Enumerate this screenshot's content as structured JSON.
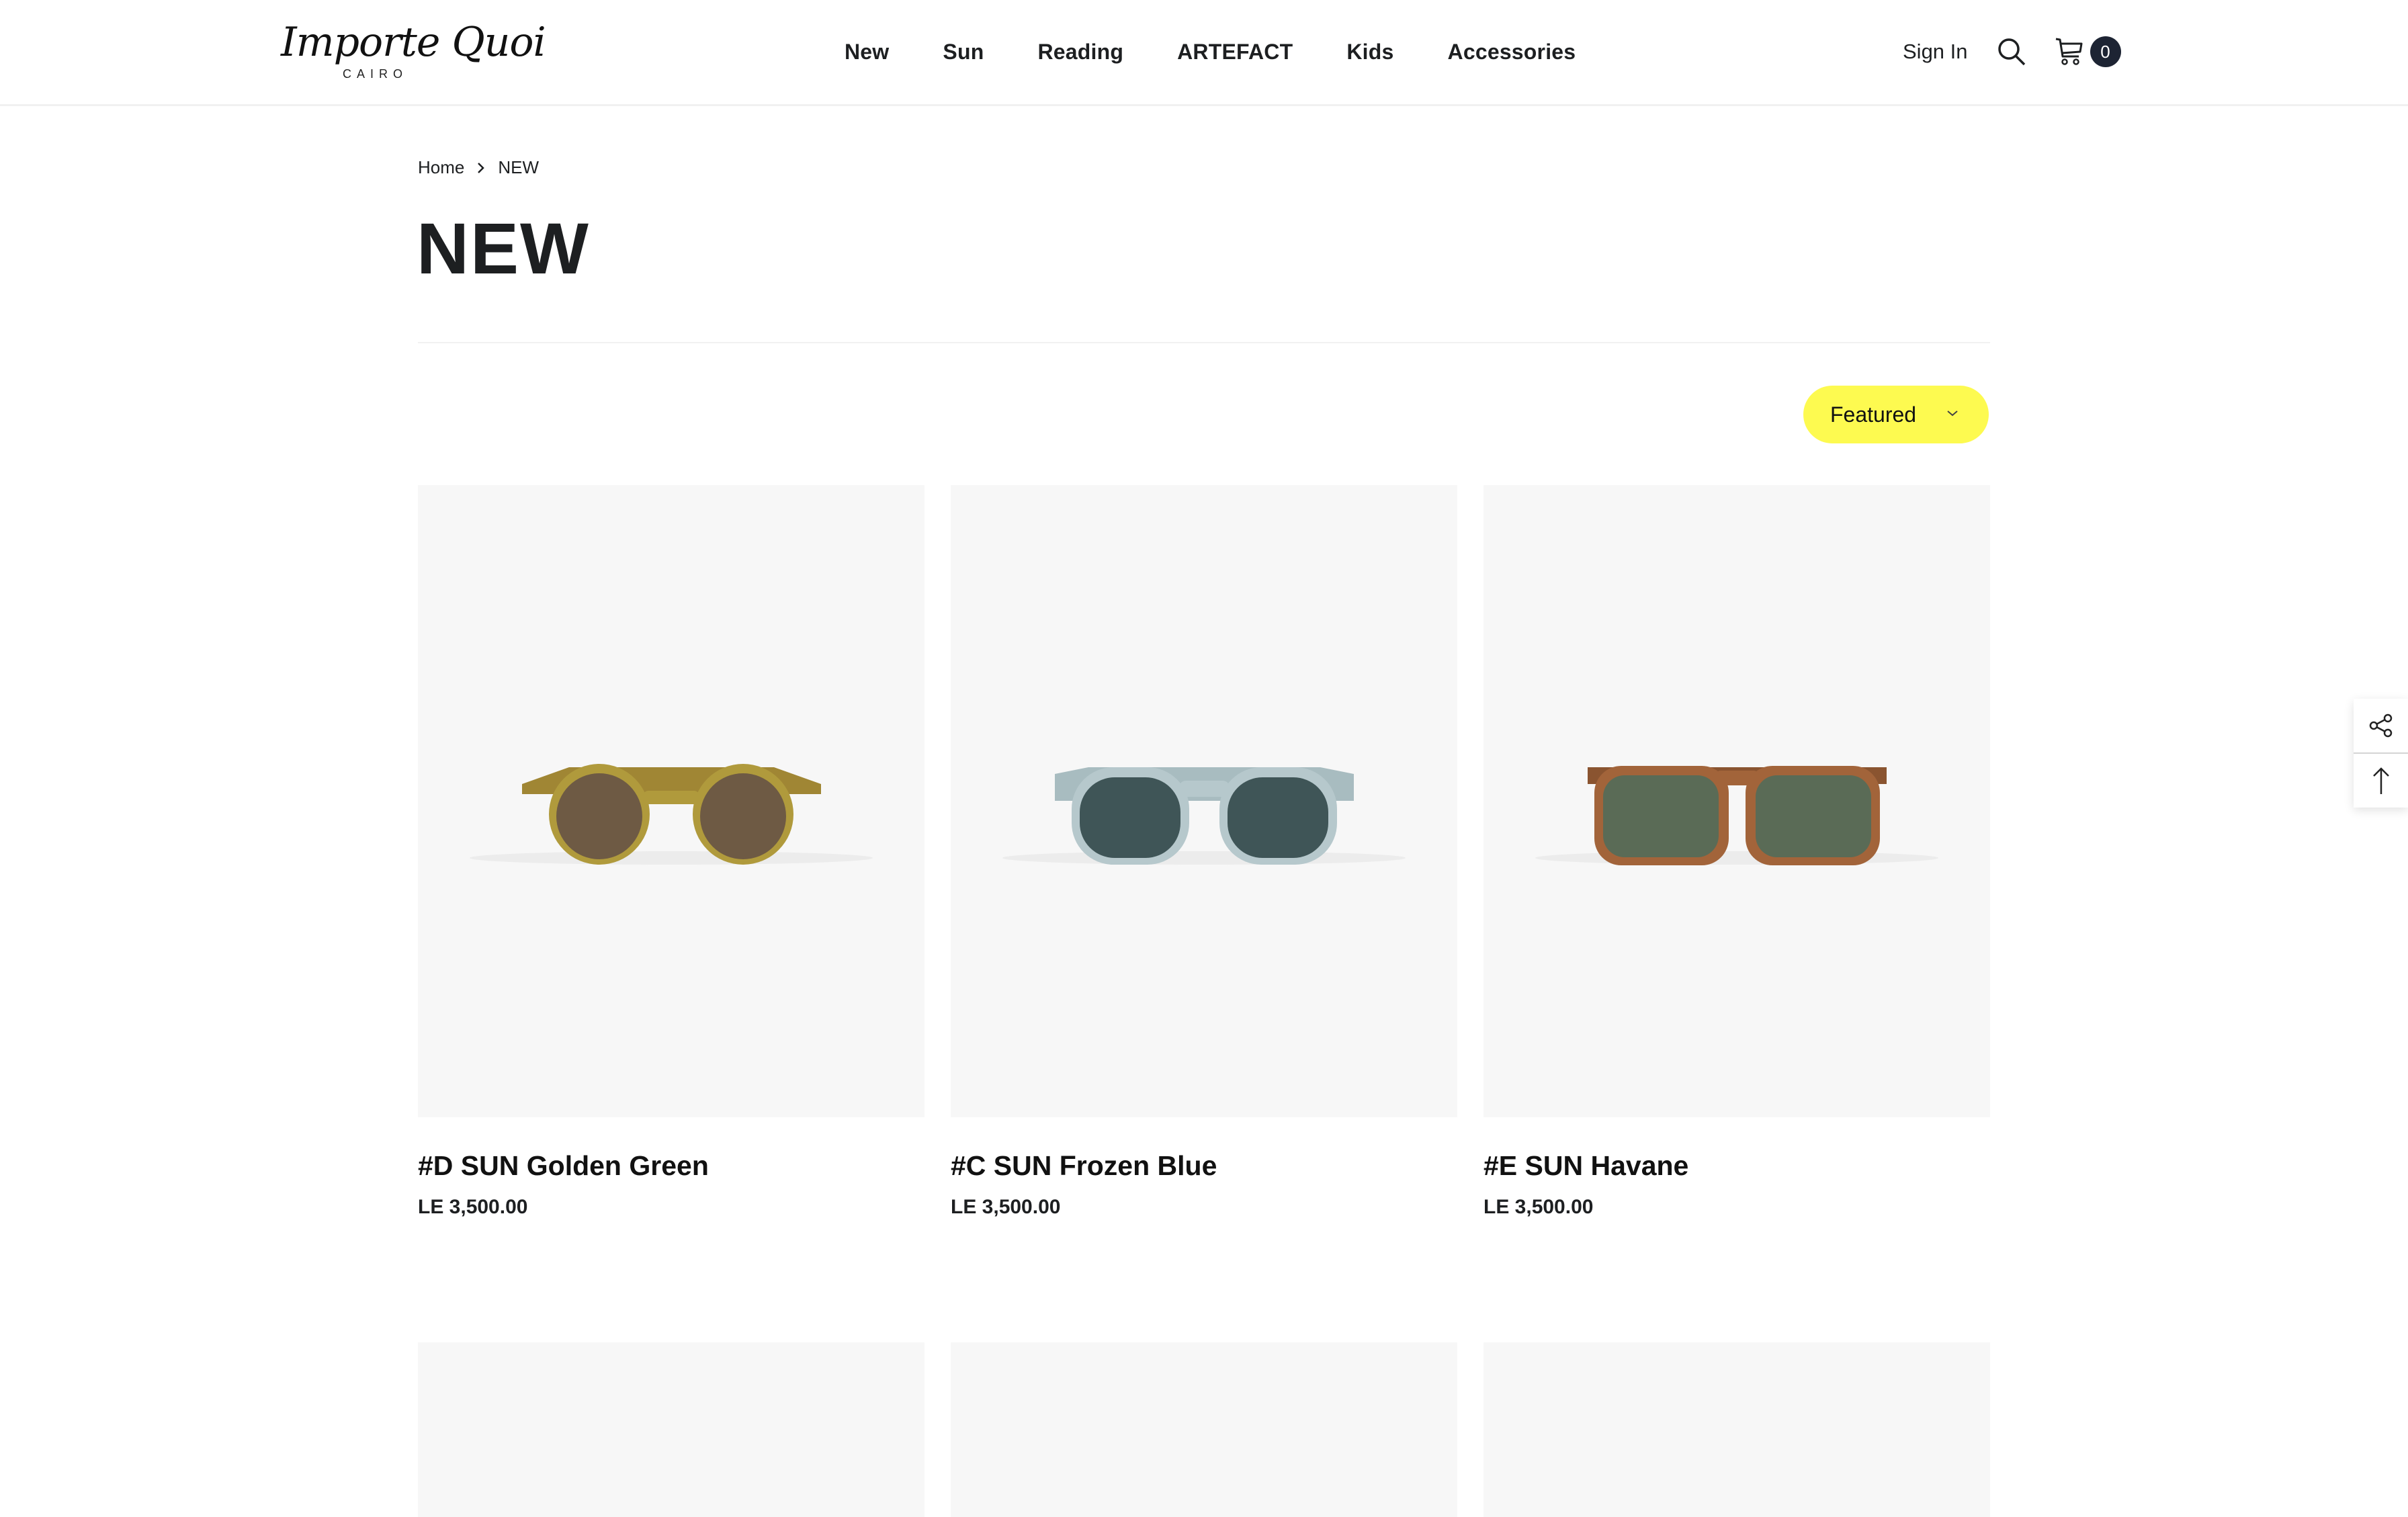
{
  "header": {
    "logo_text": "Importe Quoi",
    "logo_sub": "CAIRO",
    "nav": [
      {
        "label": "New"
      },
      {
        "label": "Sun"
      },
      {
        "label": "Reading"
      },
      {
        "label": "ARTEFACT"
      },
      {
        "label": "Kids"
      },
      {
        "label": "Accessories"
      }
    ],
    "sign_in": "Sign In",
    "search_icon": "search-icon",
    "cart_icon": "cart-icon",
    "cart_count": "0"
  },
  "breadcrumb": {
    "home": "Home",
    "current": "NEW",
    "separator_icon": "chevron-right-icon"
  },
  "page_title": "NEW",
  "sort": {
    "selected": "Featured",
    "accent_color": "#fdfa50"
  },
  "products": [
    {
      "name": "#D SUN Golden Green",
      "price": "LE 3,500.00",
      "frame_color": "#b09a3c",
      "lens_color": "#6e5a44"
    },
    {
      "name": "#C SUN Frozen Blue",
      "price": "LE 3,500.00",
      "frame_color": "#b6c8cc",
      "lens_color": "#3f5557"
    },
    {
      "name": "#E SUN Havane",
      "price": "LE 3,500.00",
      "frame_color": "#a2643a",
      "lens_color": "#5a6b56"
    }
  ],
  "side_tools": {
    "share_icon": "share-icon",
    "back_to_top_icon": "arrow-up-icon"
  }
}
